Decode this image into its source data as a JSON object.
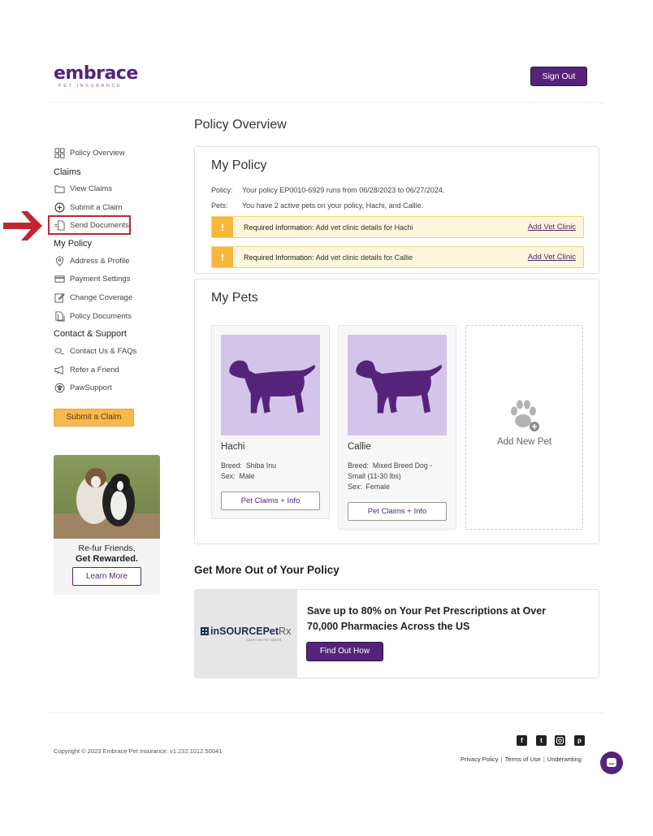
{
  "header": {
    "logo_text": "embrace",
    "logo_subtext": "PET INSURANCE",
    "sign_out_label": "Sign Out"
  },
  "sidebar": {
    "policy_overview": "Policy Overview",
    "claims_heading": "Claims",
    "view_claims": "View Claims",
    "submit_claim": "Submit a Claim",
    "send_documents": "Send Documents",
    "my_policy_heading": "My Policy",
    "address_profile": "Address & Profile",
    "payment_settings": "Payment Settings",
    "change_coverage": "Change Coverage",
    "policy_documents": "Policy Documents",
    "contact_heading": "Contact & Support",
    "contact_faqs": "Contact Us & FAQs",
    "refer_friend": "Refer a Friend",
    "pawsupport": "PawSupport",
    "submit_claim_button": "Submit a Claim",
    "promo_line1": "Re-fur Friends,",
    "promo_line2": "Get Rewarded.",
    "promo_button": "Learn More"
  },
  "main": {
    "page_title": "Policy Overview",
    "my_policy": {
      "title": "My Policy",
      "policy_label": "Policy:",
      "policy_value": "Your policy EP0010-6929 runs from 06/28/2023 to 06/27/2024.",
      "pets_label": "Pets:",
      "pets_value": "You have 2 active pets on your policy, Hachi, and Callie.",
      "alerts": [
        {
          "label": "Required Information:",
          "text": "Add vet clinic details for Hachi",
          "link": "Add Vet Clinic"
        },
        {
          "label": "Required Information:",
          "text": "Add vet clinic details for Callie",
          "link": "Add Vet Clinic"
        }
      ]
    },
    "my_pets": {
      "title": "My Pets",
      "pets": [
        {
          "name": "Hachi",
          "breed_label": "Breed:",
          "breed": "Shiba Inu",
          "sex_label": "Sex:",
          "sex": "Male",
          "button": "Pet Claims + Info"
        },
        {
          "name": "Callie",
          "breed_label": "Breed:",
          "breed": "Mixed Breed Dog - Small (11-30 lbs)",
          "sex_label": "Sex:",
          "sex": "Female",
          "button": "Pet Claims + Info"
        }
      ],
      "add_new_pet": "Add New Pet"
    },
    "get_more": {
      "title": "Get More Out of Your Policy",
      "partner_brand": "inSOURCEPet",
      "partner_brand_suffix": "Rx",
      "partner_tagline": "SAVE ON PET MEDS",
      "headline": "Save up to 80% on Your Pet Prescriptions at Over 70,000 Pharmacies Across the US",
      "button": "Find Out How"
    }
  },
  "footer": {
    "copyright": "Copyright © 2023   Embrace Pet Insurance. v1.232.1012.50041",
    "links": [
      "Privacy Policy",
      "Terms of Use",
      "Underwriting"
    ],
    "social_icons": [
      "facebook-icon",
      "twitter-icon",
      "instagram-icon",
      "pinterest-icon"
    ]
  },
  "colors": {
    "brand_purple": "#55247a",
    "accent_yellow": "#f7b84c",
    "alert_bg": "#fdf6dc",
    "pet_bg": "#d3c5ea",
    "highlight_red": "#c0272d"
  }
}
